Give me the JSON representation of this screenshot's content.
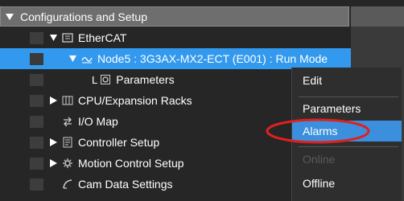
{
  "tree": {
    "header": "Configurations and Setup",
    "items": [
      {
        "label": "EtherCAT",
        "icon": "ethercat-icon"
      },
      {
        "label": "Node5 : 3G3AX-MX2-ECT (E001) : Run Mode",
        "icon": "inverter-node-icon",
        "selected": true
      },
      {
        "label": "Parameters",
        "icon": "gear-icon"
      },
      {
        "label": "CPU/Expansion Racks",
        "icon": "rack-icon"
      },
      {
        "label": "I/O Map",
        "icon": "io-map-icon"
      },
      {
        "label": "Controller Setup",
        "icon": "controller-icon"
      },
      {
        "label": "Motion Control Setup",
        "icon": "gear-icon"
      },
      {
        "label": "Cam Data Settings",
        "icon": "cam-icon"
      }
    ]
  },
  "context_menu": {
    "items": [
      {
        "label": "Edit"
      },
      {
        "label": "Parameters"
      },
      {
        "label": "Alarms",
        "highlighted": true
      },
      {
        "label": "Online",
        "disabled": true
      },
      {
        "label": "Offline"
      }
    ]
  },
  "colors": {
    "selection": "#3399ee",
    "highlight": "#3b8fdd",
    "annotation": "#e02020"
  }
}
